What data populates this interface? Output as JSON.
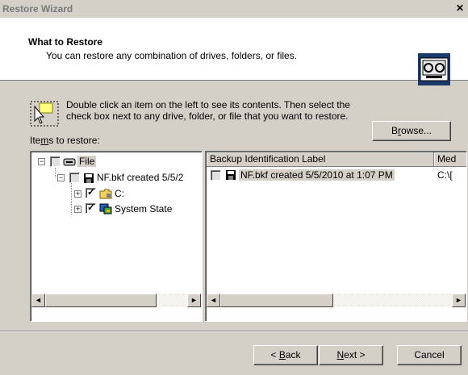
{
  "window": {
    "title": "Restore Wizard",
    "close_glyph": "✕"
  },
  "header": {
    "title": "What to Restore",
    "subtitle": "You can restore any combination of drives, folders, or files.",
    "icon": "backup-media-icon"
  },
  "instruction": {
    "line1": "Double click an item on the left to see its contents. Then select the",
    "line2": "check box next to any drive, folder, or file that you want to restore.",
    "icon": "pointer-select-icon"
  },
  "items_label": {
    "pre": "Ite",
    "accel": "m",
    "post": "s to restore:"
  },
  "browse_button": {
    "pre": "B",
    "accel": "r",
    "post": "owse..."
  },
  "tree": {
    "root": {
      "label": "File",
      "icon": "tape-drive-icon",
      "expander": "−"
    },
    "media": {
      "label": "NF.bkf created 5/5/2",
      "icon": "floppy-icon",
      "expander": "−"
    },
    "drive_c": {
      "label": "C:",
      "icon": "folder-icon",
      "expander": "+",
      "checked": true
    },
    "system_state": {
      "label": "System State",
      "icon": "system-state-icon",
      "expander": "+",
      "checked": true
    }
  },
  "list": {
    "columns": [
      "Backup Identification Label",
      "Med"
    ],
    "rows": [
      {
        "label": "NF.bkf created 5/5/2010 at 1:07 PM",
        "media": "C:\\[",
        "icon": "floppy-icon"
      }
    ]
  },
  "scroll": {
    "left": "◄",
    "right": "►"
  },
  "footer": {
    "back": {
      "pre": "< ",
      "accel": "B",
      "post": "ack"
    },
    "next": {
      "pre": "",
      "accel": "N",
      "post": "ext >"
    },
    "cancel": "Cancel"
  }
}
